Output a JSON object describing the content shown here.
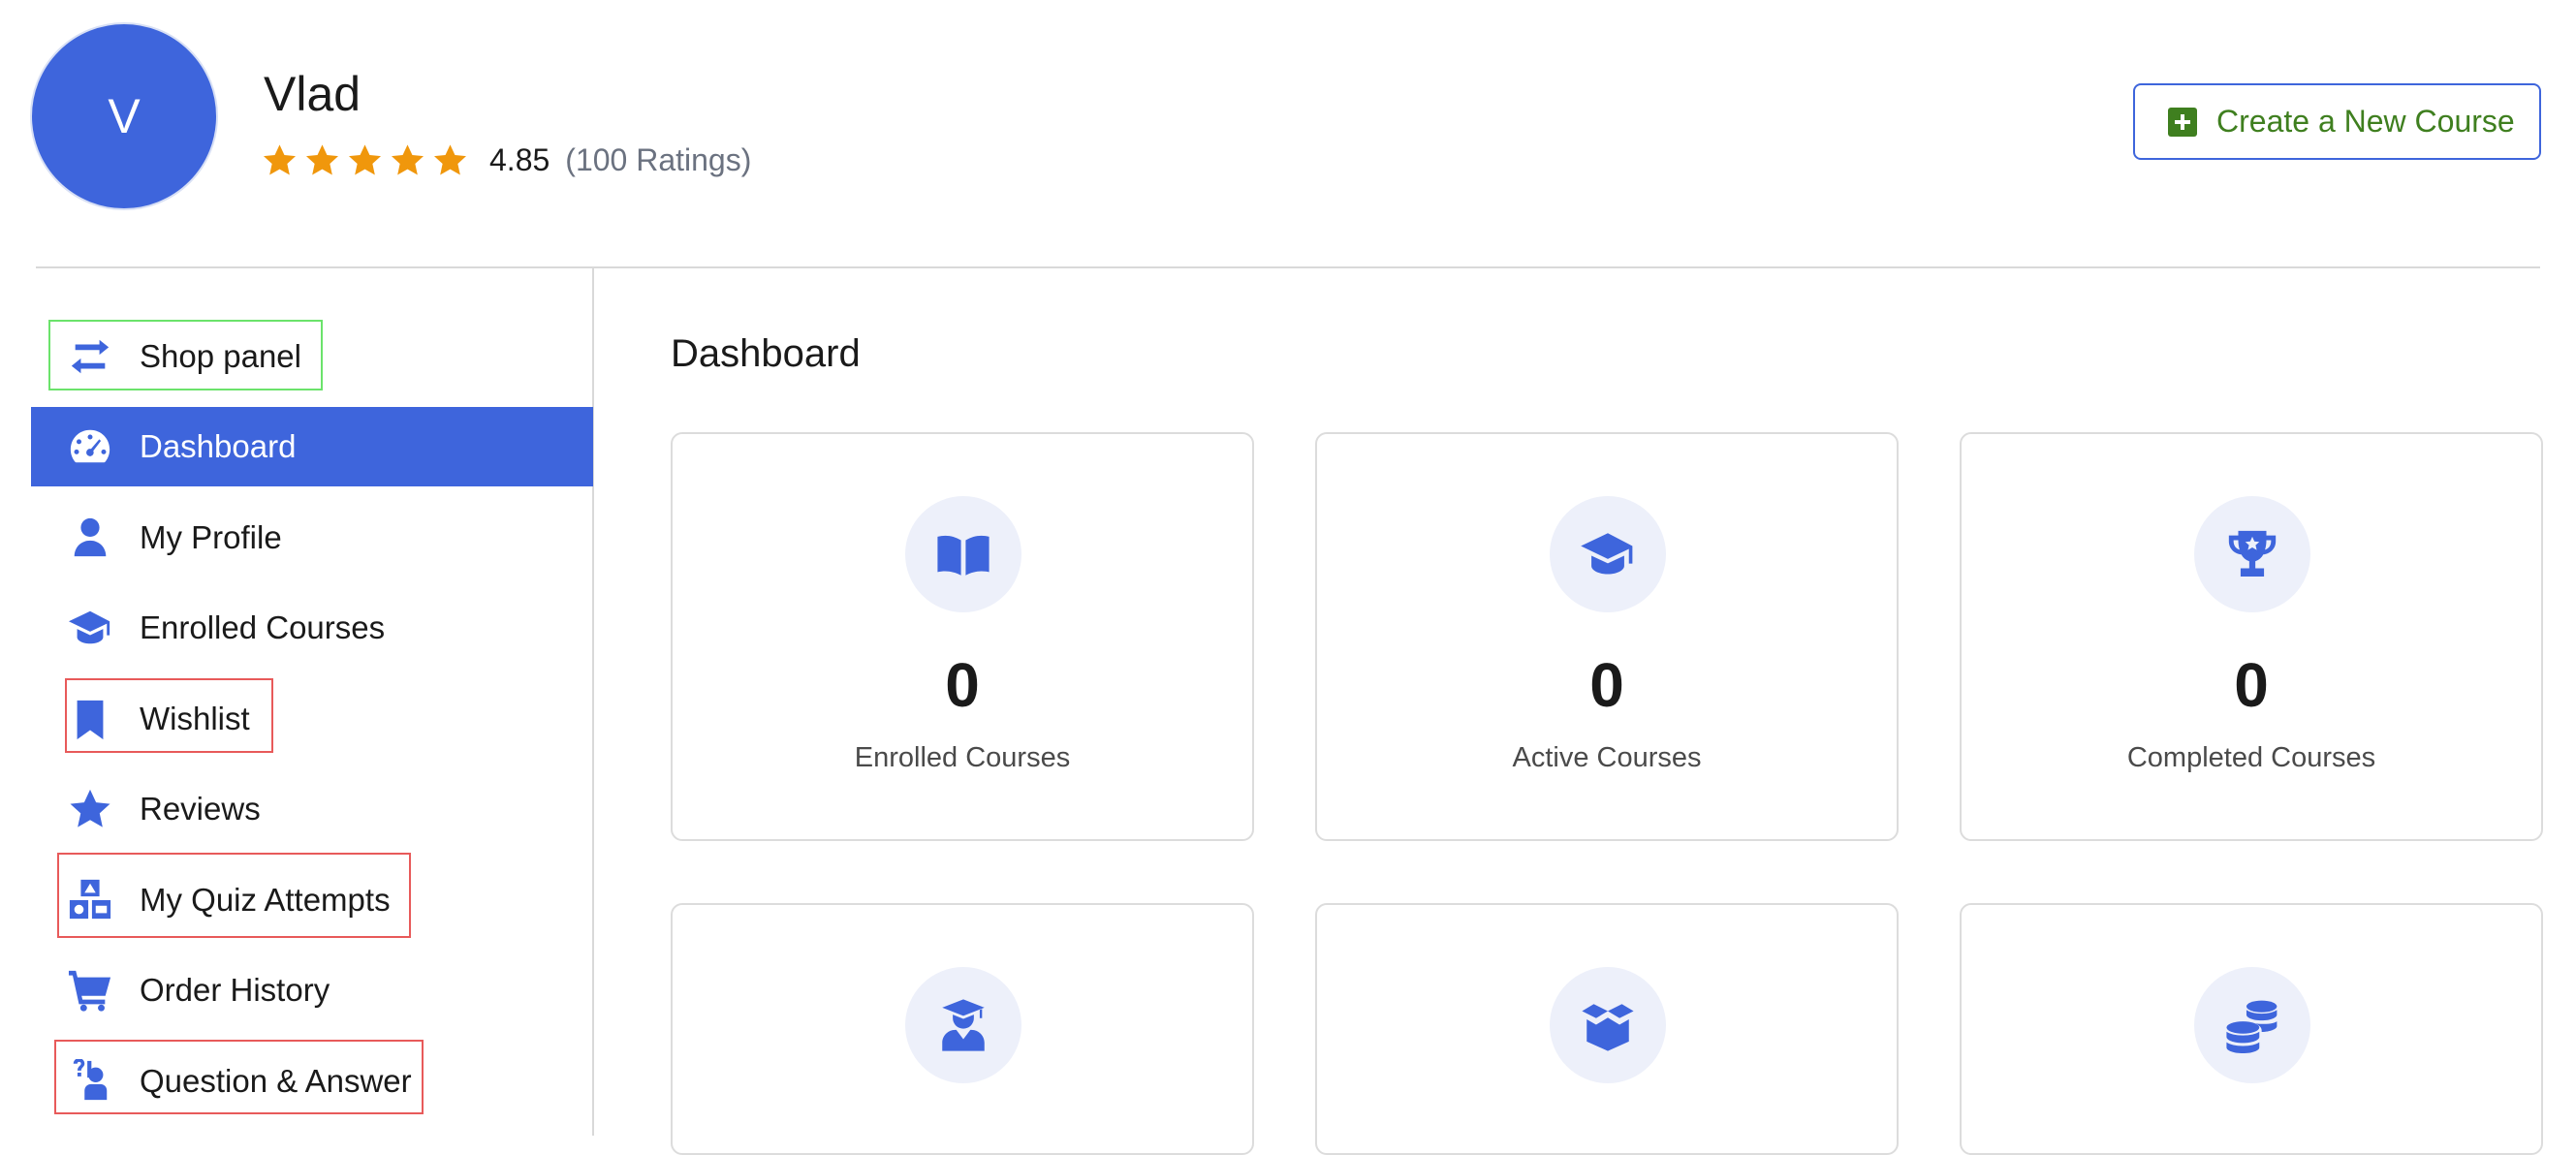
{
  "profile": {
    "avatar_letter": "V",
    "name": "Vlad",
    "rating_value": "4.85",
    "rating_count": "(100 Ratings)",
    "stars": 5,
    "star_color": "#f0970c"
  },
  "header": {
    "create_button_label": "Create a New Course",
    "accent_color": "#3e65dc",
    "create_color": "#3f7f1f"
  },
  "sidebar": {
    "items": [
      {
        "label": "Shop panel",
        "icon": "arrows-exchange-icon"
      },
      {
        "label": "Dashboard",
        "icon": "gauge-icon",
        "active": true
      },
      {
        "label": "My Profile",
        "icon": "user-icon"
      },
      {
        "label": "Enrolled Courses",
        "icon": "graduation-cap-icon"
      },
      {
        "label": "Wishlist",
        "icon": "bookmark-icon"
      },
      {
        "label": "Reviews",
        "icon": "star-icon"
      },
      {
        "label": "My Quiz Attempts",
        "icon": "shapes-icon"
      },
      {
        "label": "Order History",
        "icon": "cart-icon"
      },
      {
        "label": "Question & Answer",
        "icon": "person-question-icon"
      }
    ]
  },
  "main": {
    "title": "Dashboard",
    "cards": [
      {
        "value": "0",
        "label": "Enrolled Courses",
        "icon": "book-open-icon"
      },
      {
        "value": "0",
        "label": "Active Courses",
        "icon": "graduation-cap-icon"
      },
      {
        "value": "0",
        "label": "Completed Courses",
        "icon": "trophy-icon"
      },
      {
        "icon": "student-icon"
      },
      {
        "icon": "open-box-icon"
      },
      {
        "icon": "coins-icon"
      }
    ]
  }
}
